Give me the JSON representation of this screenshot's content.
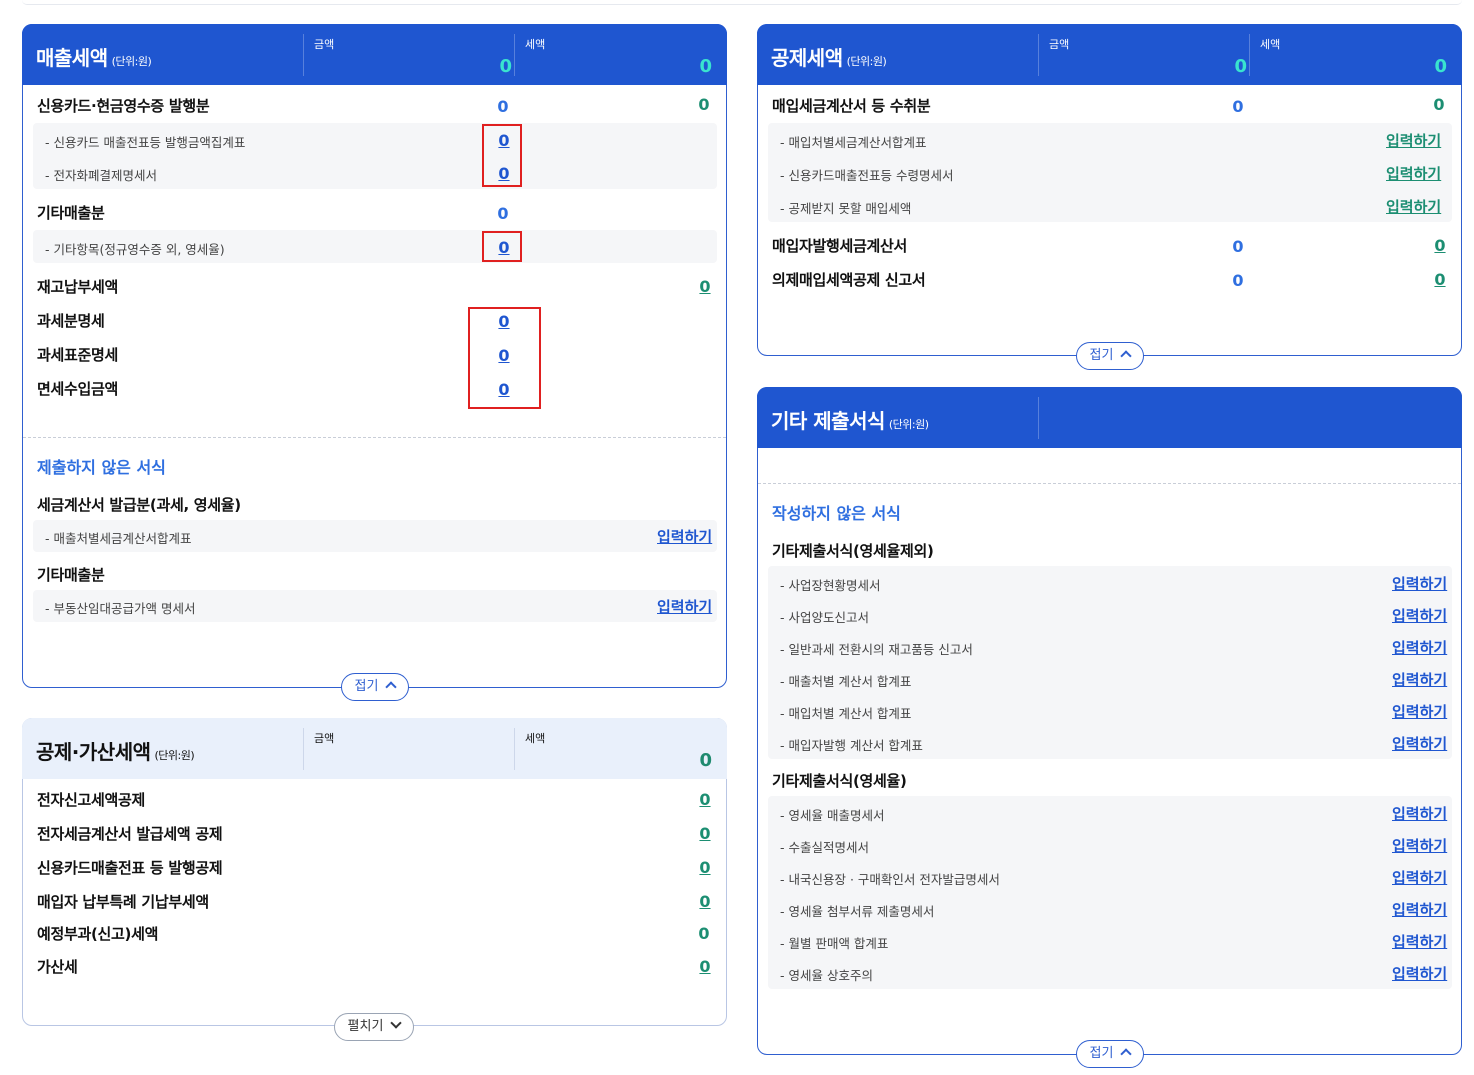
{
  "sales_tax": {
    "title": "매출세액",
    "unit": "(단위:원)",
    "amount_header": "금액",
    "tax_header": "세액",
    "amount_total": "0",
    "tax_total": "0",
    "rows": {
      "card_cash": {
        "label": "신용카드·현금영수증 발행분",
        "amount": "0",
        "tax": "0"
      },
      "card_slip": {
        "label": "- 신용카드 매출전표등 발행금액집계표",
        "amount": "0"
      },
      "e_money": {
        "label": "- 전자화폐결제명세서",
        "amount": "0"
      },
      "other_sales": {
        "label": "기타매출분",
        "amount": "0"
      },
      "other_items": {
        "label": "- 기타항목(정규영수증 외, 영세율)",
        "amount": "0"
      },
      "inventory": {
        "label": "재고납부세액",
        "tax": "0"
      },
      "taxable_detail": {
        "label": "과세분명세",
        "amount": "0"
      },
      "tax_base_detail": {
        "label": "과세표준명세",
        "amount": "0"
      },
      "exempt_income": {
        "label": "면세수입금액",
        "amount": "0"
      }
    },
    "unsubmitted_title": "제출하지 않은 서식",
    "invoice_group": "세금계산서 발급분(과세, 영세율)",
    "invoice_item": "- 매출처별세금계산서합계표",
    "other_group": "기타매출분",
    "other_item": "- 부동산임대공급가액 명세서",
    "input_label": "입력하기",
    "collapse_label": "접기"
  },
  "deduct_add": {
    "title": "공제·가산세액",
    "unit": "(단위:원)",
    "amount_header": "금액",
    "tax_header": "세액",
    "tax_total": "0",
    "rows": [
      {
        "label": "전자신고세액공제",
        "tax": "0"
      },
      {
        "label": "전자세금계산서 발급세액 공제",
        "tax": "0"
      },
      {
        "label": "신용카드매출전표 등 발행공제",
        "tax": "0"
      },
      {
        "label": "매입자 납부특례 기납부세액",
        "tax": "0"
      },
      {
        "label": "예정부과(신고)세액",
        "tax": "0"
      },
      {
        "label": "가산세",
        "tax": "0"
      }
    ],
    "expand_label": "펼치기"
  },
  "input_tax": {
    "title": "공제세액",
    "unit": "(단위:원)",
    "amount_header": "금액",
    "tax_header": "세액",
    "amount_total": "0",
    "tax_total": "0",
    "purchase_invoice": {
      "label": "매입세금계산서 등 수취분",
      "amount": "0",
      "tax": "0"
    },
    "sub_items": [
      "- 매입처별세금계산서합계표",
      "- 신용카드매출전표등 수령명세서",
      "- 공제받지 못할 매입세액"
    ],
    "buyer_issued": {
      "label": "매입자발행세금계산서",
      "amount": "0",
      "tax": "0"
    },
    "deemed_input": {
      "label": "의제매입세액공제 신고서",
      "amount": "0",
      "tax": "0"
    },
    "input_label": "입력하기",
    "collapse_label": "접기"
  },
  "other_forms": {
    "title": "기타 제출서식",
    "unit": "(단위:원)",
    "unwritten_title": "작성하지 않은 서식",
    "group1": "기타제출서식(영세율제외)",
    "group1_items": [
      "- 사업장현황명세서",
      "- 사업양도신고서",
      "- 일반과세 전환시의 재고품등 신고서",
      "- 매출처별 계산서 합계표",
      "- 매입처별 계산서 합계표",
      "- 매입자발행 계산서 합계표"
    ],
    "group2": "기타제출서식(영세율)",
    "group2_items": [
      "- 영세율 매출명세서",
      "- 수출실적명세서",
      "- 내국신용장 · 구매확인서 전자발급명세서",
      "- 영세율 첨부서류 제출명세서",
      "- 월별 판매액 합계표",
      "- 영세율 상호주의"
    ],
    "input_label": "입력하기",
    "collapse_label": "접기"
  }
}
